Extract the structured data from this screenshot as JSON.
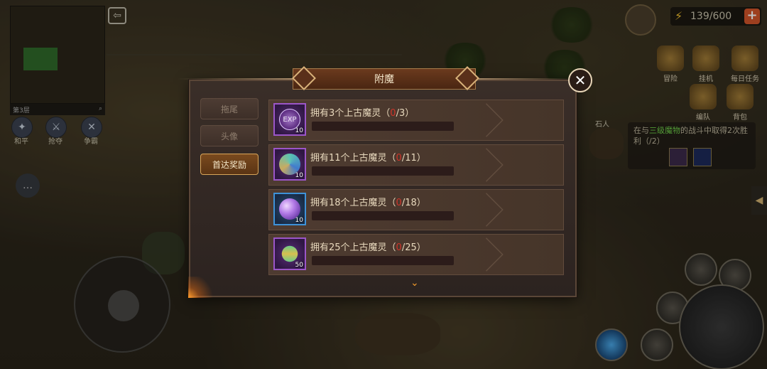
{
  "hud": {
    "minimap_floor": "第3层",
    "energy": "139/600",
    "energy_plus": "+",
    "stone_label": "石人",
    "menu": [
      {
        "label": "冒险"
      },
      {
        "label": "挂机"
      },
      {
        "label": "每日任务"
      },
      {
        "label": "编队"
      },
      {
        "label": "背包"
      }
    ],
    "left_buttons": [
      {
        "label": "和平"
      },
      {
        "label": "抢夺"
      },
      {
        "label": "争霸"
      }
    ],
    "quest": {
      "text_before": "在与",
      "highlight": "三级魔物",
      "text_after": "的战斗中取得2次胜利（",
      "current": "/2",
      "close_paren": "）"
    }
  },
  "dialog": {
    "title": "附魔",
    "close_icon": "close-icon",
    "tabs": [
      {
        "label": "拖尾",
        "active": false
      },
      {
        "label": "头像",
        "active": false
      },
      {
        "label": "首达奖励",
        "active": true
      }
    ],
    "rows": [
      {
        "title": "拥有3个上古魔灵（",
        "current": "0",
        "target": "/3）",
        "reward_icon": "exp-orb-icon",
        "reward_qty": "10",
        "progress": 0,
        "frame": "purple"
      },
      {
        "title": "拥有11个上古魔灵（",
        "current": "0",
        "target": "/11）",
        "reward_icon": "bow-icon",
        "reward_qty": "10",
        "progress": 0,
        "frame": "purple"
      },
      {
        "title": "拥有18个上古魔灵（",
        "current": "0",
        "target": "/18）",
        "reward_icon": "crystal-icon",
        "reward_qty": "10",
        "progress": 0,
        "frame": "blue"
      },
      {
        "title": "拥有25个上古魔灵（",
        "current": "0",
        "target": "/25）",
        "reward_icon": "gem-icon",
        "reward_qty": "50",
        "progress": 0,
        "frame": "purple"
      }
    ]
  },
  "colors": {
    "accent": "#d8a55a",
    "progress_text": "#d0342a",
    "quest_highlight": "#6fcf4a"
  }
}
